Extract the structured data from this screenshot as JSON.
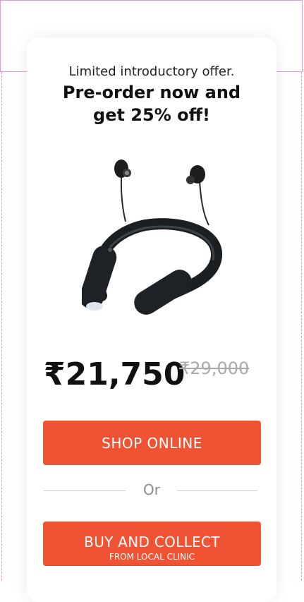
{
  "offer": {
    "kicker": "Limited introductory offer.",
    "headline_line1": "Pre-order now and",
    "headline_line2": "get 25% off!"
  },
  "product": {
    "icon": "neckband-earphones-image"
  },
  "pricing": {
    "price": "₹21,750",
    "old_price": "₹29,000"
  },
  "actions": {
    "shop_online": "SHOP ONLINE",
    "or_text": "Or",
    "buy_collect": "BUY AND COLLECT",
    "buy_collect_sub": "FROM LOCAL CLINIC"
  },
  "colors": {
    "accent": "#ef5333"
  }
}
